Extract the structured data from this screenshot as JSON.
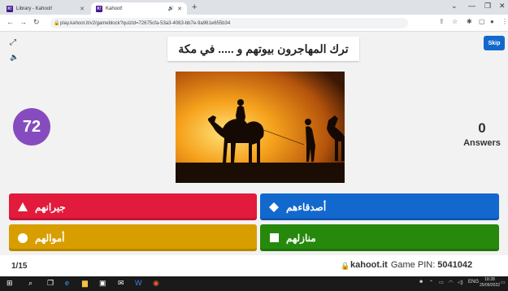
{
  "browser": {
    "tabs": [
      {
        "label": "Library - Kahoot!",
        "favicon": "K!",
        "active": false
      },
      {
        "label": "Kahoot!",
        "favicon": "K!",
        "active": true
      }
    ],
    "new_tab_glyph": "+",
    "url": "play.kahoot.it/v2/gameblock?quizId=72675cfa-53a3-4063-bb7e-9a961e655b34",
    "window_controls": [
      "minimize-icon",
      "restore-icon",
      "close-icon"
    ]
  },
  "game": {
    "question": "ترك المهاجرون بيوتهم و ..... في مكة",
    "skip_label": "Skip",
    "timer": "72",
    "answers_count": "0",
    "answers_label": "Answers",
    "image_alt_icon": "camel-caravan-sunset-image",
    "answers": [
      {
        "text": "جيرانهم",
        "shape": "triangle-icon",
        "color": "#e21b3c"
      },
      {
        "text": "أصدقاءهم",
        "shape": "diamond-icon",
        "color": "#1368ce"
      },
      {
        "text": "أموالهم",
        "shape": "circle-icon",
        "color": "#d89e00"
      },
      {
        "text": "منازلهم",
        "shape": "square-icon",
        "color": "#26890c"
      }
    ]
  },
  "footer": {
    "counter": "1/15",
    "brand": "kahoot.it",
    "pin_label": "Game PIN:",
    "pin_value": "5041042"
  },
  "taskbar": {
    "time": "18:28",
    "date": "25/09/2022",
    "lang": "ENG"
  },
  "colors": {
    "purple": "#864cbf",
    "skip_blue": "#1368ce"
  }
}
